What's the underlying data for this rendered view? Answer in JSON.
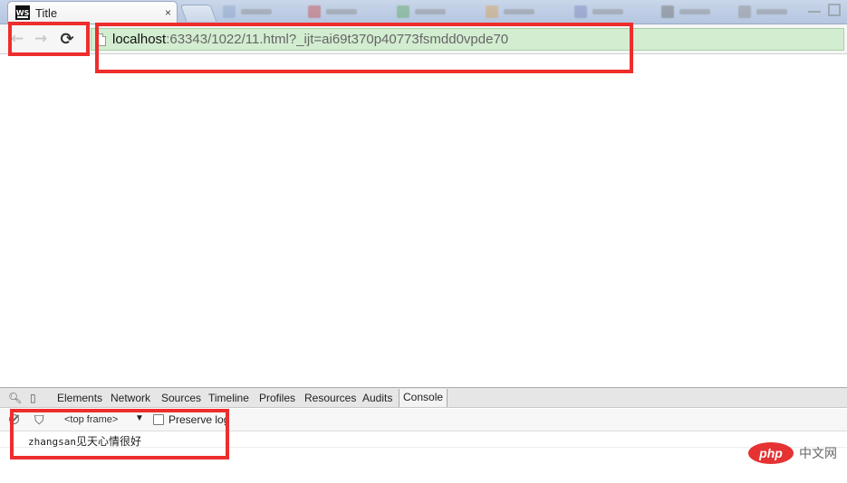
{
  "tab": {
    "title": "Title",
    "favicon": "WS",
    "close": "×"
  },
  "nav": {
    "back": "←",
    "forward": "→",
    "reload": "⟳"
  },
  "omnibox": {
    "host": "localhost",
    "rest": ":63343/1022/11.html?_ijt=ai69t370p40773fsmdd0vpde70"
  },
  "devtools": {
    "tabs": [
      "Elements",
      "Network",
      "Sources",
      "Timeline",
      "Profiles",
      "Resources",
      "Audits",
      "Console"
    ],
    "active_tab": "Console",
    "icons": {
      "inspect": "search-icon",
      "device": "mobile-icon"
    }
  },
  "console": {
    "frame": "<top frame>",
    "frame_arrow": "▼",
    "preserve_log": "Preserve log",
    "filter_icon": "⛉",
    "message_prefix": "zhangsan",
    "message_text": "见天心情很好"
  },
  "watermark": {
    "logo": "php",
    "text": "中文网"
  },
  "colors": {
    "omnibox_bg": "#d3edd1",
    "annotation_red": "#ee2d2d",
    "watermark_red": "#e63232"
  }
}
